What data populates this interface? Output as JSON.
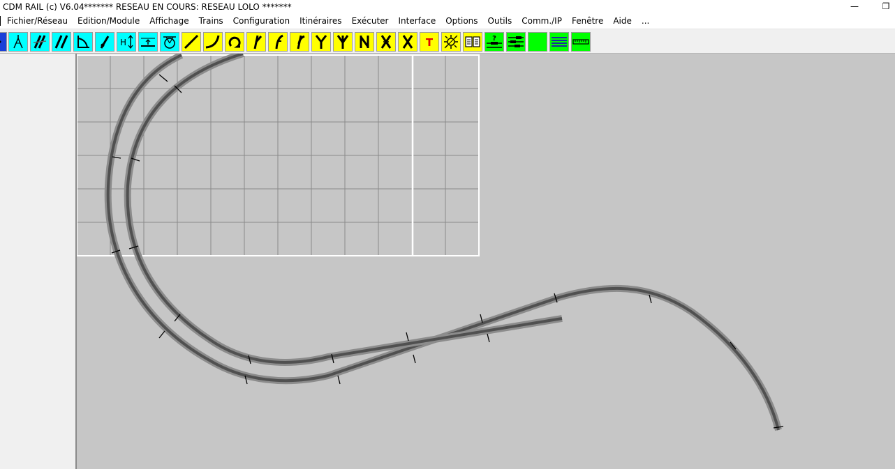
{
  "window": {
    "app_title": "CDM RAIL (c) V6.04",
    "document_title": "******* RESEAU EN COURS: RESEAU LOLO *******",
    "controls": {
      "minimize": "—",
      "restore": "❐"
    }
  },
  "menu": {
    "items": [
      "Fichier/Réseau",
      "Edition/Module",
      "Affichage",
      "Trains",
      "Configuration",
      "Itinéraires",
      "Exécuter",
      "Interface",
      "Options",
      "Outils",
      "Comm./IP",
      "Fenêtre",
      "Aide",
      "..."
    ]
  },
  "toolbar": {
    "buttons": [
      {
        "name": "scroll-arrow-icon",
        "color": "#1a3fd8"
      },
      {
        "name": "compass-icon",
        "color": "#00ffff"
      },
      {
        "name": "slanted-double-track-icon",
        "color": "#00ffff"
      },
      {
        "name": "double-track-icon",
        "color": "#00ffff"
      },
      {
        "name": "angle-icon",
        "color": "#00ffff"
      },
      {
        "name": "bent-segment-icon",
        "color": "#00ffff"
      },
      {
        "name": "height-icon",
        "color": "#00ffff",
        "text": "H"
      },
      {
        "name": "level-icon",
        "color": "#00ffff"
      },
      {
        "name": "turntable-icon",
        "color": "#00ffff"
      },
      {
        "name": "straight-track-icon",
        "color": "#ffff00"
      },
      {
        "name": "curve-track-icon",
        "color": "#ffff00"
      },
      {
        "name": "loop-track-icon",
        "color": "#ffff00"
      },
      {
        "name": "switch-right-icon",
        "color": "#ffff00"
      },
      {
        "name": "switch-left-icon",
        "color": "#ffff00"
      },
      {
        "name": "curved-switch-icon",
        "color": "#ffff00"
      },
      {
        "name": "y-switch-icon",
        "color": "#ffff00"
      },
      {
        "name": "three-way-switch-icon",
        "color": "#ffff00"
      },
      {
        "name": "double-slip-icon",
        "color": "#ffff00"
      },
      {
        "name": "crossing-slip-icon",
        "color": "#ffff00"
      },
      {
        "name": "crossing-icon",
        "color": "#ffff00"
      },
      {
        "name": "text-icon",
        "color": "#ffff00",
        "text": "T",
        "text_color": "#e00000"
      },
      {
        "name": "signal-light-icon",
        "color": "#ffff00"
      },
      {
        "name": "book-icon",
        "color": "#ffff00"
      },
      {
        "name": "help-route-icon",
        "color": "#00ff00"
      },
      {
        "name": "block-list-icon",
        "color": "#00ff00"
      },
      {
        "name": "green-block-icon",
        "color": "#00ff00"
      },
      {
        "name": "layers-icon",
        "color": "#00ff00"
      },
      {
        "name": "ruler-icon",
        "color": "#00ff00"
      }
    ]
  },
  "layout": {
    "background_color": "#c6c6c6",
    "grid_color": "#8a8a8a",
    "grid_border_color": "#ffffff",
    "track_rail_color": "#505050",
    "track_ballast_color": "#8c8c8c"
  }
}
